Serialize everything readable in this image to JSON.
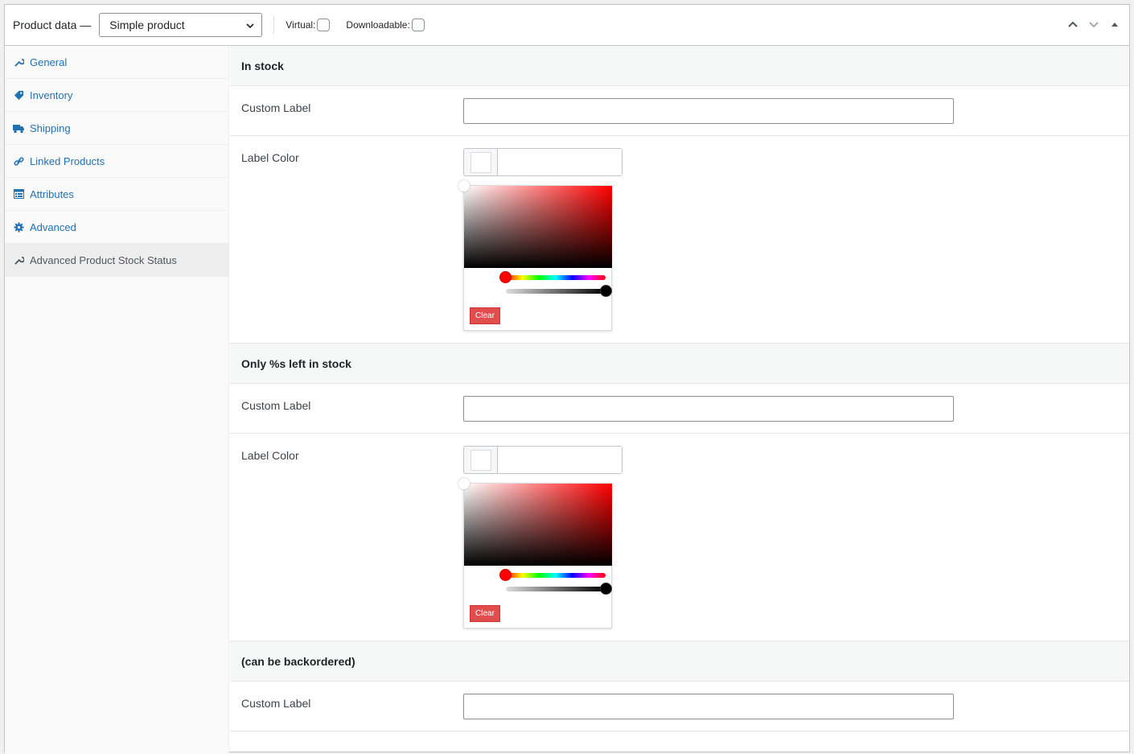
{
  "header": {
    "title": "Product data —",
    "product_type": "Simple product",
    "virtual_label": "Virtual:",
    "downloadable_label": "Downloadable:"
  },
  "sidebar": {
    "items": [
      {
        "label": "General",
        "icon": "wrench-icon"
      },
      {
        "label": "Inventory",
        "icon": "tag-icon"
      },
      {
        "label": "Shipping",
        "icon": "truck-icon"
      },
      {
        "label": "Linked Products",
        "icon": "link-icon"
      },
      {
        "label": "Attributes",
        "icon": "table-icon"
      },
      {
        "label": "Advanced",
        "icon": "gear-icon"
      },
      {
        "label": "Advanced Product Stock Status",
        "icon": "wrench-icon"
      }
    ]
  },
  "sections": [
    {
      "title": "In stock",
      "custom_label": "Custom Label",
      "color_label": "Label Color",
      "clear": "Clear"
    },
    {
      "title": "Only %s left in stock",
      "custom_label": "Custom Label",
      "color_label": "Label Color",
      "clear": "Clear"
    },
    {
      "title": "(can be backordered)",
      "custom_label": "Custom Label"
    }
  ],
  "colors": {
    "accent": "#2271b1",
    "clear_button": "#e14d4d"
  }
}
